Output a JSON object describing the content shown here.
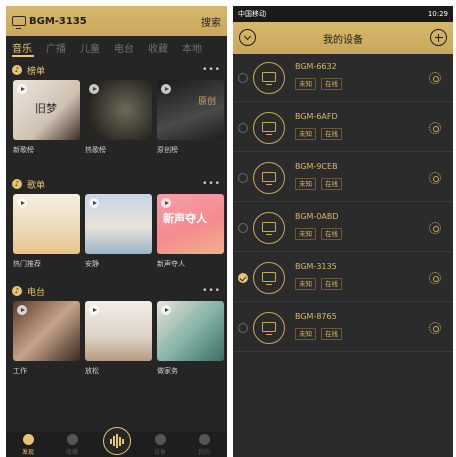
{
  "left": {
    "device_name": "BGM-3135",
    "search_label": "搜索",
    "tabs": [
      "音乐",
      "广播",
      "儿童",
      "电台",
      "收藏",
      "本地"
    ],
    "sections": [
      {
        "title": "榜单",
        "more": "•••",
        "items": [
          {
            "caption": "新歌榜",
            "thumb_text": "旧梦"
          },
          {
            "caption": "热歌榜",
            "thumb_text": ""
          },
          {
            "caption": "原创榜",
            "thumb_text": "原创"
          }
        ]
      },
      {
        "title": "歌单",
        "more": "•••",
        "items": [
          {
            "caption": "热门推荐",
            "thumb_text": ""
          },
          {
            "caption": "安静",
            "thumb_text": ""
          },
          {
            "caption": "新声夺人",
            "thumb_text": "新声夺人"
          }
        ]
      },
      {
        "title": "电台",
        "more": "•••",
        "items": [
          {
            "caption": "工作",
            "thumb_text": ""
          },
          {
            "caption": "放松",
            "thumb_text": ""
          },
          {
            "caption": "做家务",
            "thumb_text": ""
          }
        ]
      }
    ],
    "bottom_nav": [
      "发现",
      "收藏",
      "",
      "设备",
      "我的"
    ],
    "active_nav": 0,
    "accent_color": "#e8c572"
  },
  "right": {
    "status": {
      "carrier": "中国移动",
      "time": "10:29"
    },
    "title": "我的设备",
    "devices": [
      {
        "name": "BGM-6632",
        "state1": "未知",
        "state2": "在线",
        "checked": false
      },
      {
        "name": "BGM-6AFD",
        "state1": "未知",
        "state2": "在线",
        "checked": false
      },
      {
        "name": "BGM-9CEB",
        "state1": "未知",
        "state2": "在线",
        "checked": false
      },
      {
        "name": "BGM-0ABD",
        "state1": "未知",
        "state2": "在线",
        "checked": false
      },
      {
        "name": "BGM-3135",
        "state1": "未知",
        "state2": "在线",
        "checked": true
      },
      {
        "name": "BGM-8765",
        "state1": "未知",
        "state2": "在线",
        "checked": false
      }
    ],
    "header_color": "#c9a85a"
  }
}
